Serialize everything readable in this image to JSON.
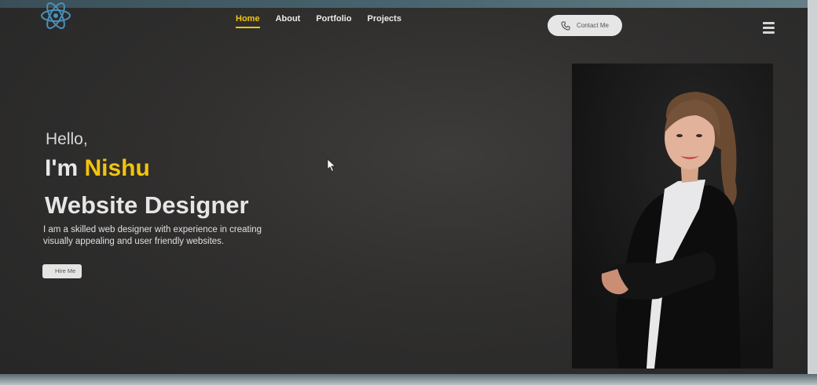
{
  "nav": {
    "items": [
      {
        "label": "Home",
        "active": true
      },
      {
        "label": "About",
        "active": false
      },
      {
        "label": "Portfolio",
        "active": false
      },
      {
        "label": "Projects",
        "active": false
      }
    ],
    "contact_label": "Contact Me",
    "logo_icon": "react-atom-icon",
    "menu_icon": "hamburger-menu-icon"
  },
  "hero": {
    "greeting": "Hello,",
    "intro_prefix": "I'm ",
    "name": "Nishu",
    "role": "Website Designer",
    "description": "I am a skilled web designer with experience in creating visually appealing and user friendly websites.",
    "hire_label": "Hire Me"
  },
  "colors": {
    "accent": "#f1c40f",
    "background": "#2e2e2f",
    "text": "#e6e6e6"
  }
}
